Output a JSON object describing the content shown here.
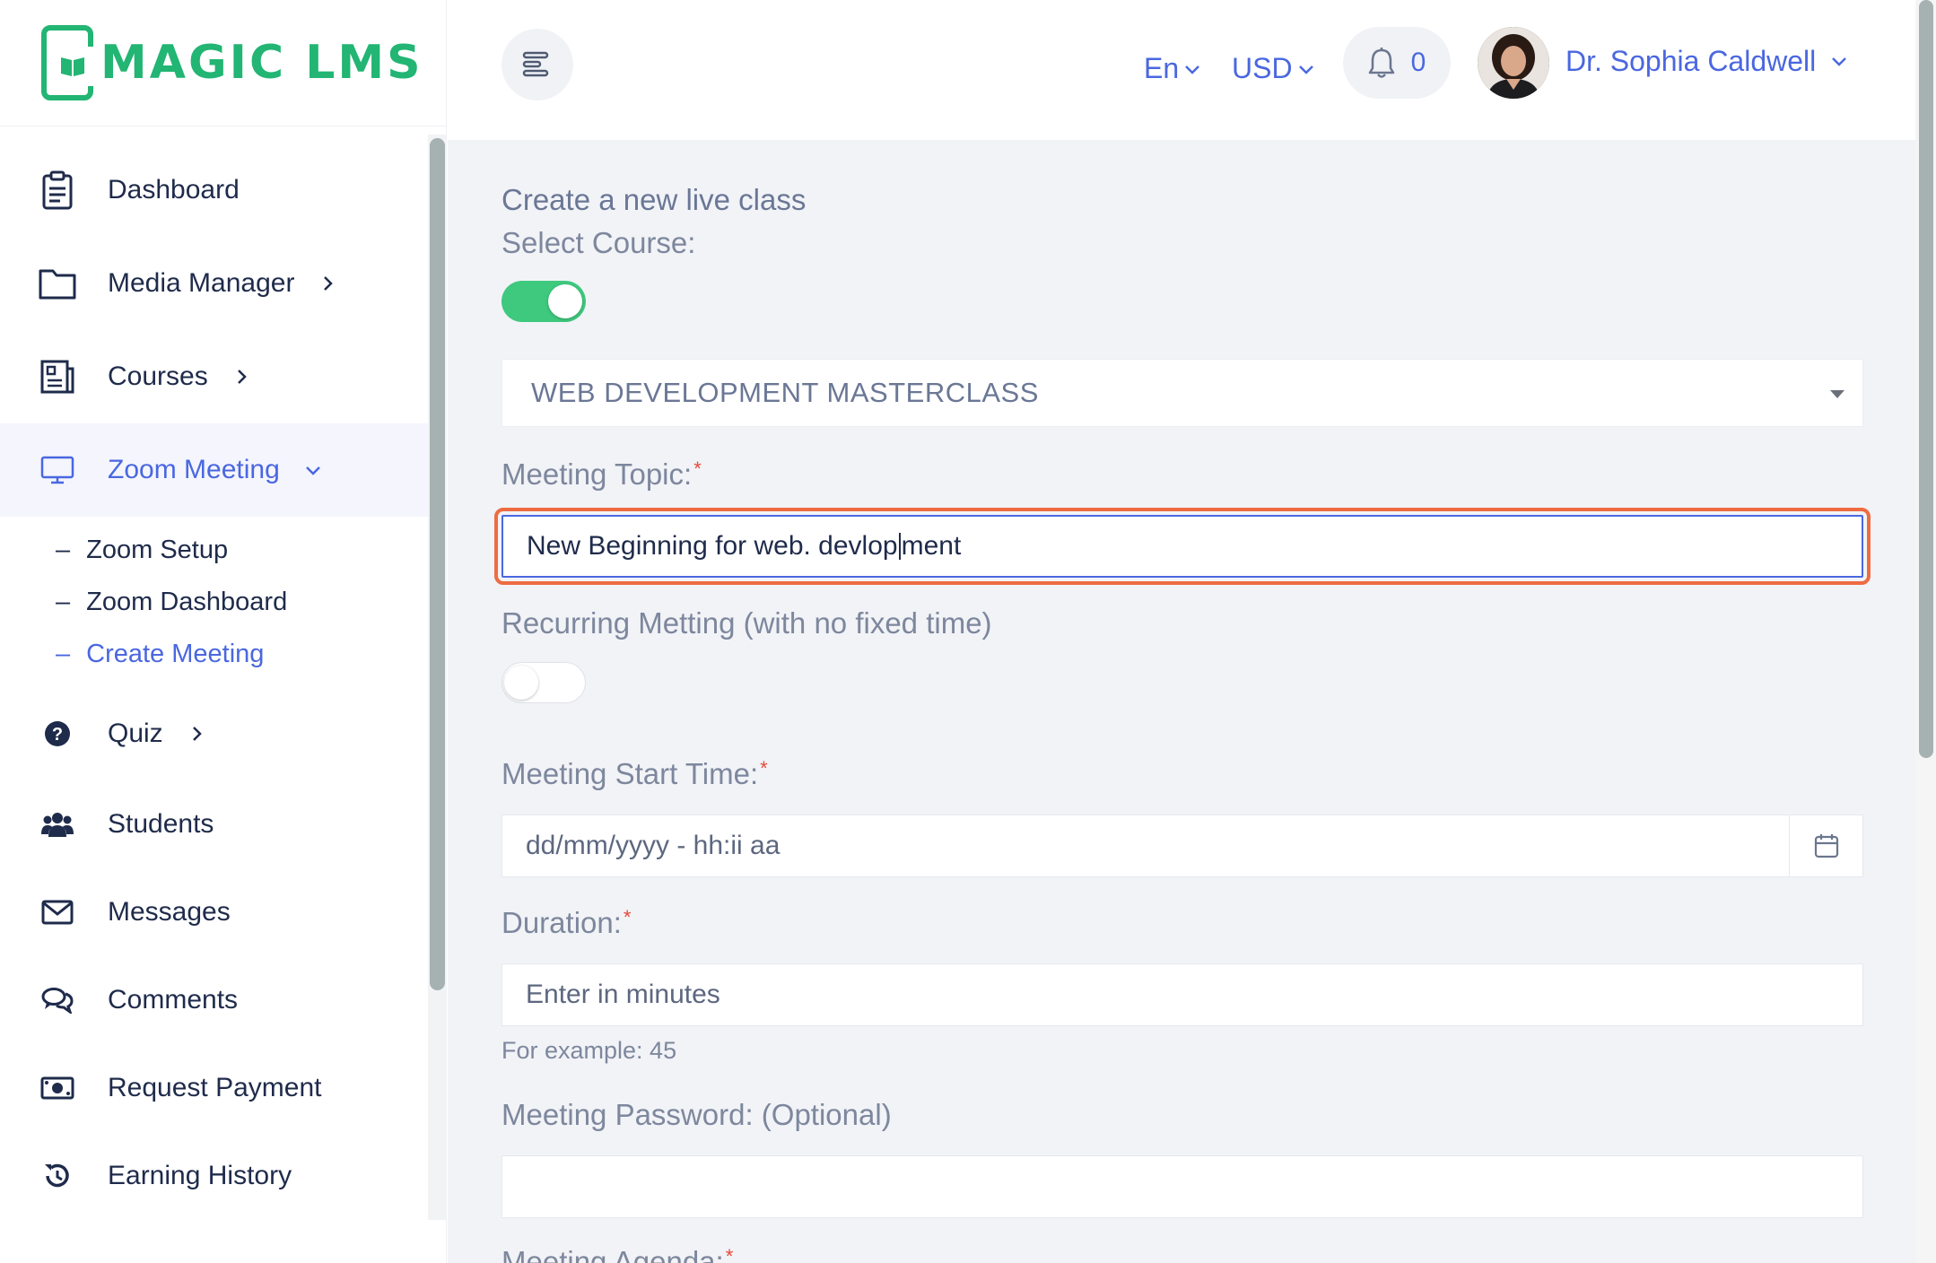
{
  "brand": {
    "name": "MAGIC LMS",
    "color": "#22b573"
  },
  "accent": "#4a67e0",
  "sidebar": {
    "items": [
      {
        "label": "Dashboard",
        "icon": "clipboard-icon"
      },
      {
        "label": "Media Manager",
        "icon": "folder-icon",
        "has_children": true
      },
      {
        "label": "Courses",
        "icon": "courses-icon",
        "has_children": true
      },
      {
        "label": "Zoom Meeting",
        "icon": "monitor-icon",
        "expanded": true,
        "active": true
      },
      {
        "label": "Quiz",
        "icon": "question-circle-icon",
        "has_children": true
      },
      {
        "label": "Students",
        "icon": "users-icon"
      },
      {
        "label": "Messages",
        "icon": "envelope-icon"
      },
      {
        "label": "Comments",
        "icon": "comments-icon"
      },
      {
        "label": "Request Payment",
        "icon": "money-icon"
      },
      {
        "label": "Earning History",
        "icon": "history-icon"
      }
    ],
    "zoom_sub": [
      {
        "label": "Zoom Setup"
      },
      {
        "label": "Zoom Dashboard"
      },
      {
        "label": "Create Meeting",
        "active": true
      }
    ]
  },
  "header": {
    "language": "En",
    "currency": "USD",
    "notification_count": "0",
    "user_name": "Dr. Sophia Caldwell"
  },
  "form": {
    "title": "Create a new live class",
    "select_course_label": "Select Course:",
    "select_course_toggle": "on",
    "course_value": "WEB DEVELOPMENT MASTERCLASS",
    "topic_label": "Meeting Topic:",
    "topic_value_before_caret": "New Beginning for web. devlop",
    "topic_value_after_caret": "ment",
    "recurring_label": "Recurring Metting (with no fixed time)",
    "recurring_toggle": "off",
    "start_time_label": "Meeting Start Time:",
    "start_time_placeholder": "dd/mm/yyyy - hh:ii aa",
    "duration_label": "Duration:",
    "duration_placeholder": "Enter in minutes",
    "duration_hint": "For example: 45",
    "password_label": "Meeting Password: (Optional)",
    "password_value": "",
    "agenda_label": "Meeting Agenda:",
    "required_mark": "*"
  }
}
